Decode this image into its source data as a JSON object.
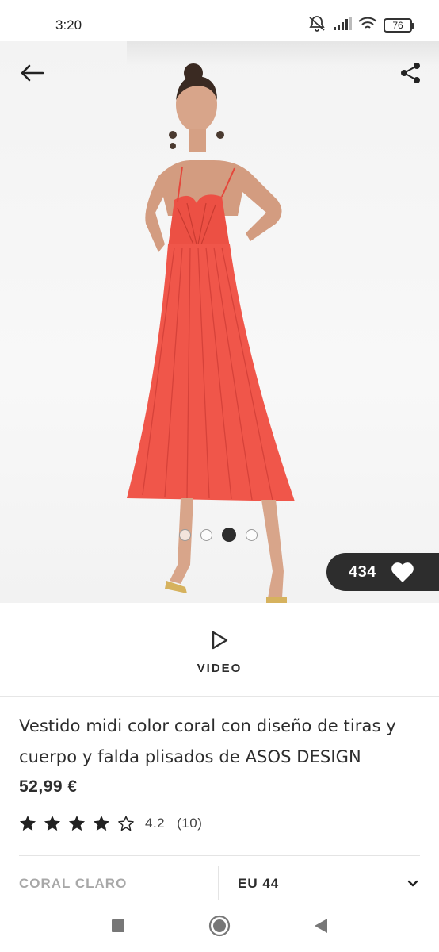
{
  "status_bar": {
    "time": "3:20",
    "battery": "76",
    "icons": [
      "mute-icon",
      "signal-icon",
      "wifi-icon",
      "battery-icon"
    ]
  },
  "gallery": {
    "total_images": 4,
    "active_index": 2,
    "likes": "434"
  },
  "video": {
    "label": "VIDEO"
  },
  "product": {
    "title": "Vestido midi color coral con diseño de tiras y cuerpo y falda plisados de ASOS DESIGN",
    "price": "52,99 €",
    "rating_value": "4.2",
    "rating_count": "(10)",
    "stars_filled": 4,
    "stars_total": 5
  },
  "selectors": {
    "colour": "CORAL CLARO",
    "size": "EU 44"
  },
  "colors": {
    "accent_dark": "#2d2d2d",
    "dress": "#f0564a",
    "muted_text": "#a8a8a8"
  }
}
